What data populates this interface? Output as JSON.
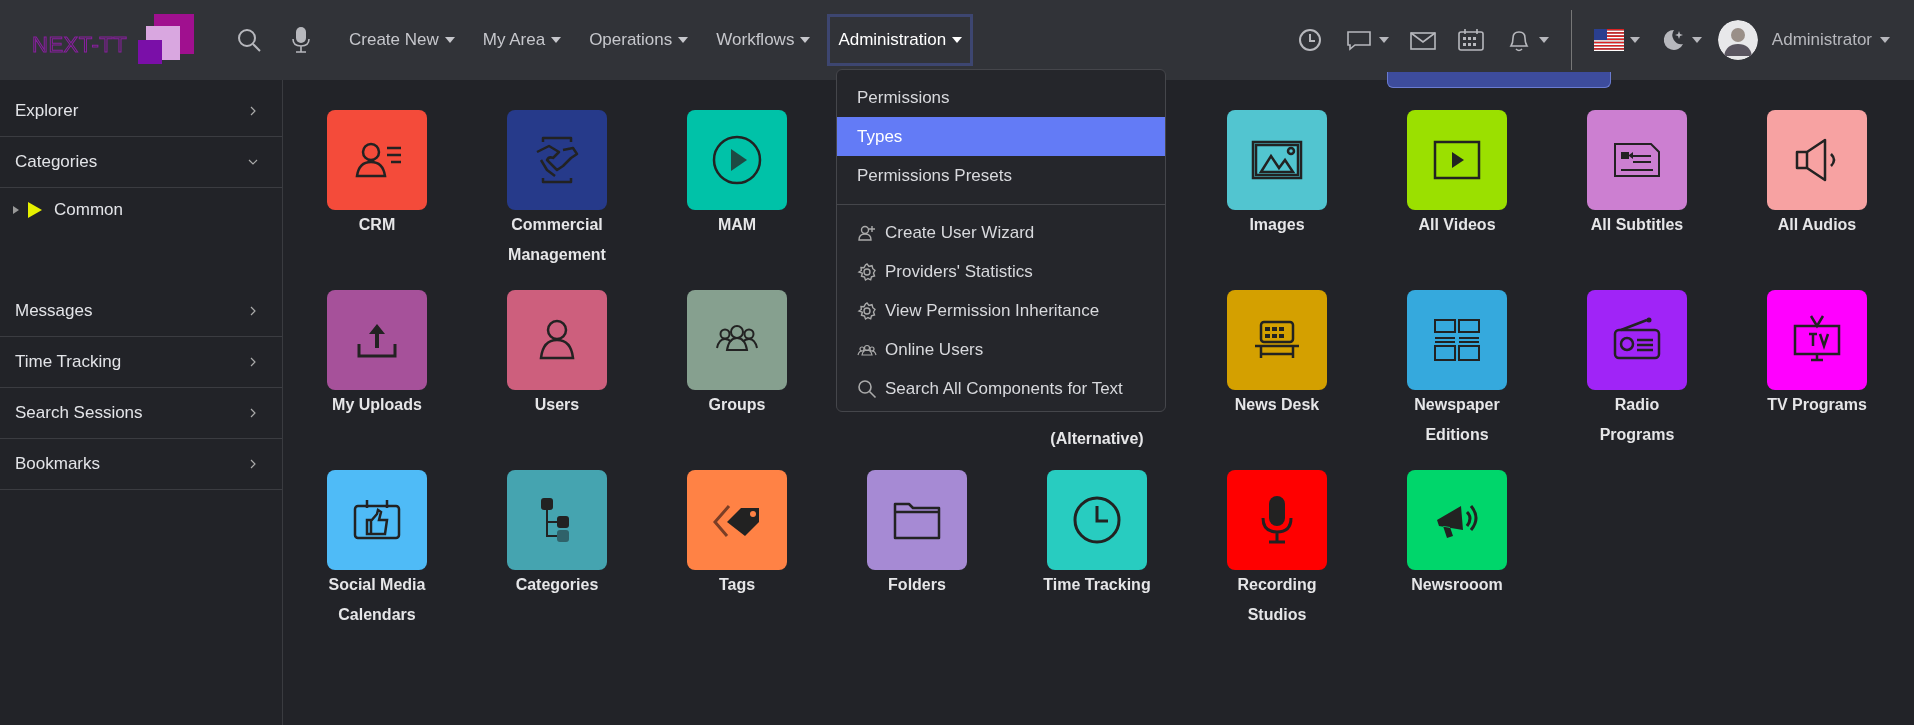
{
  "logo": "NEXT-TT",
  "nav_items": [
    {
      "label": "Create New",
      "selected": false
    },
    {
      "label": "My Area",
      "selected": false
    },
    {
      "label": "Operations",
      "selected": false
    },
    {
      "label": "Workflows",
      "selected": false
    },
    {
      "label": "Administration",
      "selected": true
    }
  ],
  "user": {
    "name": "Administrator"
  },
  "sidebar": {
    "items": [
      {
        "label": "Explorer",
        "expanded": false
      },
      {
        "label": "Categories",
        "expanded": true,
        "children": [
          {
            "label": "Common",
            "expanded": false
          }
        ]
      },
      {
        "label": "Messages",
        "expanded": false
      },
      {
        "label": "Time Tracking",
        "expanded": false
      },
      {
        "label": "Search Sessions",
        "expanded": false
      },
      {
        "label": "Bookmarks",
        "expanded": false
      }
    ]
  },
  "tiles": [
    {
      "kind": "app",
      "label": [
        "CRM"
      ],
      "color": "#f44b3a"
    },
    {
      "kind": "app",
      "label": [
        "Commercial",
        "Management"
      ],
      "color": "#263a8a"
    },
    {
      "kind": "app",
      "label": [
        "MAM"
      ],
      "color": "#00c2a8"
    },
    {
      "kind": "covered"
    },
    {
      "kind": "covered"
    },
    {
      "kind": "app",
      "label": [
        "Images"
      ],
      "color": "#52c5d0"
    },
    {
      "kind": "app",
      "label": [
        "All Videos"
      ],
      "color": "#9be000"
    },
    {
      "kind": "app",
      "label": [
        "All Subtitles"
      ],
      "color": "#cc7fd1"
    },
    {
      "kind": "app",
      "label": [
        "All Audios"
      ],
      "color": "#f7a2a2"
    },
    {
      "kind": "app",
      "label": [
        "My Uploads"
      ],
      "color": "#a6519a"
    },
    {
      "kind": "app",
      "label": [
        "Users"
      ],
      "color": "#cd5f7d"
    },
    {
      "kind": "app",
      "label": [
        "Groups"
      ],
      "color": "#86a08f"
    },
    {
      "kind": "covered"
    },
    {
      "kind": "covered",
      "label_tail": "(Alternative)"
    },
    {
      "kind": "app",
      "label": [
        "News Desk"
      ],
      "color": "#d4a000"
    },
    {
      "kind": "app",
      "label": [
        "Newspaper",
        "Editions"
      ],
      "color": "#35a9dd"
    },
    {
      "kind": "app",
      "label": [
        "Radio",
        "Programs"
      ],
      "color": "#a024f7"
    },
    {
      "kind": "app",
      "label": [
        "TV Programs"
      ],
      "color": "#ff00ff"
    },
    {
      "kind": "app",
      "label": [
        "Social Media",
        "Calendars"
      ],
      "color": "#4fbbf7"
    },
    {
      "kind": "app",
      "label": [
        "Categories"
      ],
      "color": "#45a4b0"
    },
    {
      "kind": "app",
      "label": [
        "Tags"
      ],
      "color": "#ff8245"
    },
    {
      "kind": "app",
      "label": [
        "Folders"
      ],
      "color": "#a68ad4"
    },
    {
      "kind": "app",
      "label": [
        "Time Tracking"
      ],
      "color": "#28ccc0"
    },
    {
      "kind": "app",
      "label": [
        "Recording",
        "Studios"
      ],
      "color": "#ff0000"
    },
    {
      "kind": "app",
      "label": [
        "Newsrooom"
      ],
      "color": "#00d66b"
    }
  ],
  "dropdown": {
    "sections": [
      [
        {
          "label": "Permissions",
          "selected": false
        },
        {
          "label": "Types",
          "selected": true
        },
        {
          "label": "Permissions Presets",
          "selected": false
        }
      ],
      [
        {
          "label": "Create User Wizard",
          "selected": false
        },
        {
          "label": "Providers' Statistics",
          "selected": false
        },
        {
          "label": "View Permission Inheritance",
          "selected": false
        },
        {
          "label": "Online Users",
          "selected": false
        },
        {
          "label": "Search All Components for Text",
          "selected": false
        }
      ]
    ]
  }
}
